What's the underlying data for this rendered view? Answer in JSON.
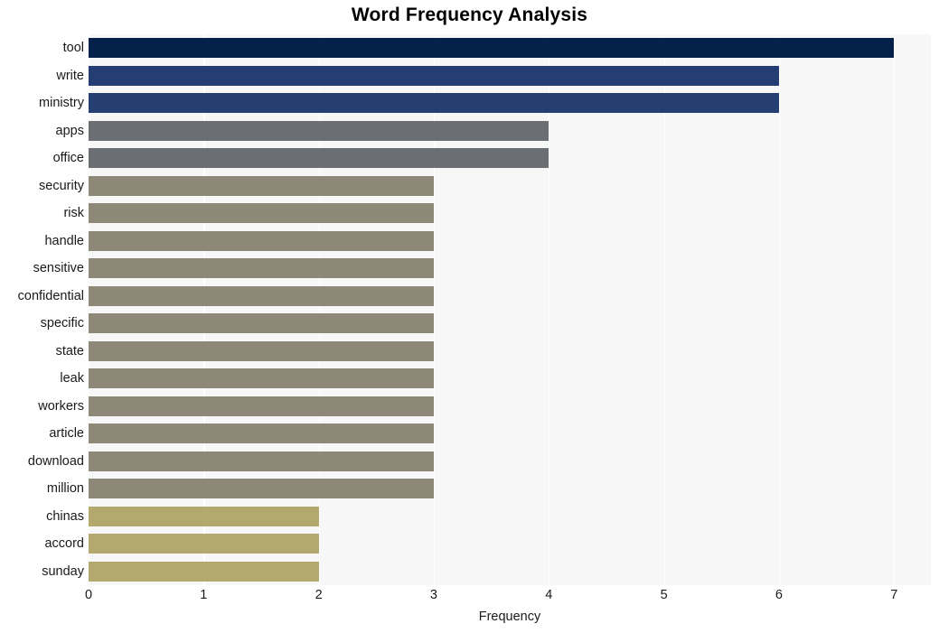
{
  "chart_data": {
    "type": "bar",
    "orientation": "horizontal",
    "title": "Word Frequency Analysis",
    "xlabel": "Frequency",
    "ylabel": "",
    "xlim": [
      0,
      7.32
    ],
    "xticks": [
      "0",
      "1",
      "2",
      "3",
      "4",
      "5",
      "6",
      "7"
    ],
    "xtick_values": [
      0,
      1,
      2,
      3,
      4,
      5,
      6,
      7
    ],
    "grid": "vertical-white",
    "legend": "none",
    "categories": [
      "tool",
      "write",
      "ministry",
      "apps",
      "office",
      "security",
      "risk",
      "handle",
      "sensitive",
      "confidential",
      "specific",
      "state",
      "leak",
      "workers",
      "article",
      "download",
      "million",
      "chinas",
      "accord",
      "sunday"
    ],
    "values": [
      7,
      6,
      6,
      4,
      4,
      3,
      3,
      3,
      3,
      3,
      3,
      3,
      3,
      3,
      3,
      3,
      3,
      2,
      2,
      2
    ],
    "bar_colors": [
      "#042249",
      "#243d72",
      "#253f72",
      "#6b6e73",
      "#6b6e73",
      "#8d8878",
      "#8d8878",
      "#8d8878",
      "#8d8878",
      "#8d8878",
      "#8d8878",
      "#8d8878",
      "#8d8878",
      "#8d8878",
      "#8d8878",
      "#8d8878",
      "#8d8878",
      "#b3a86e",
      "#b3a86e",
      "#b3a86e"
    ]
  },
  "style": {
    "plot_background": "#f7f7f7",
    "page_background": "#ffffff",
    "gridline_color": "#ffffff",
    "title_color": "#000000",
    "tick_color": "#1a1a1a"
  }
}
